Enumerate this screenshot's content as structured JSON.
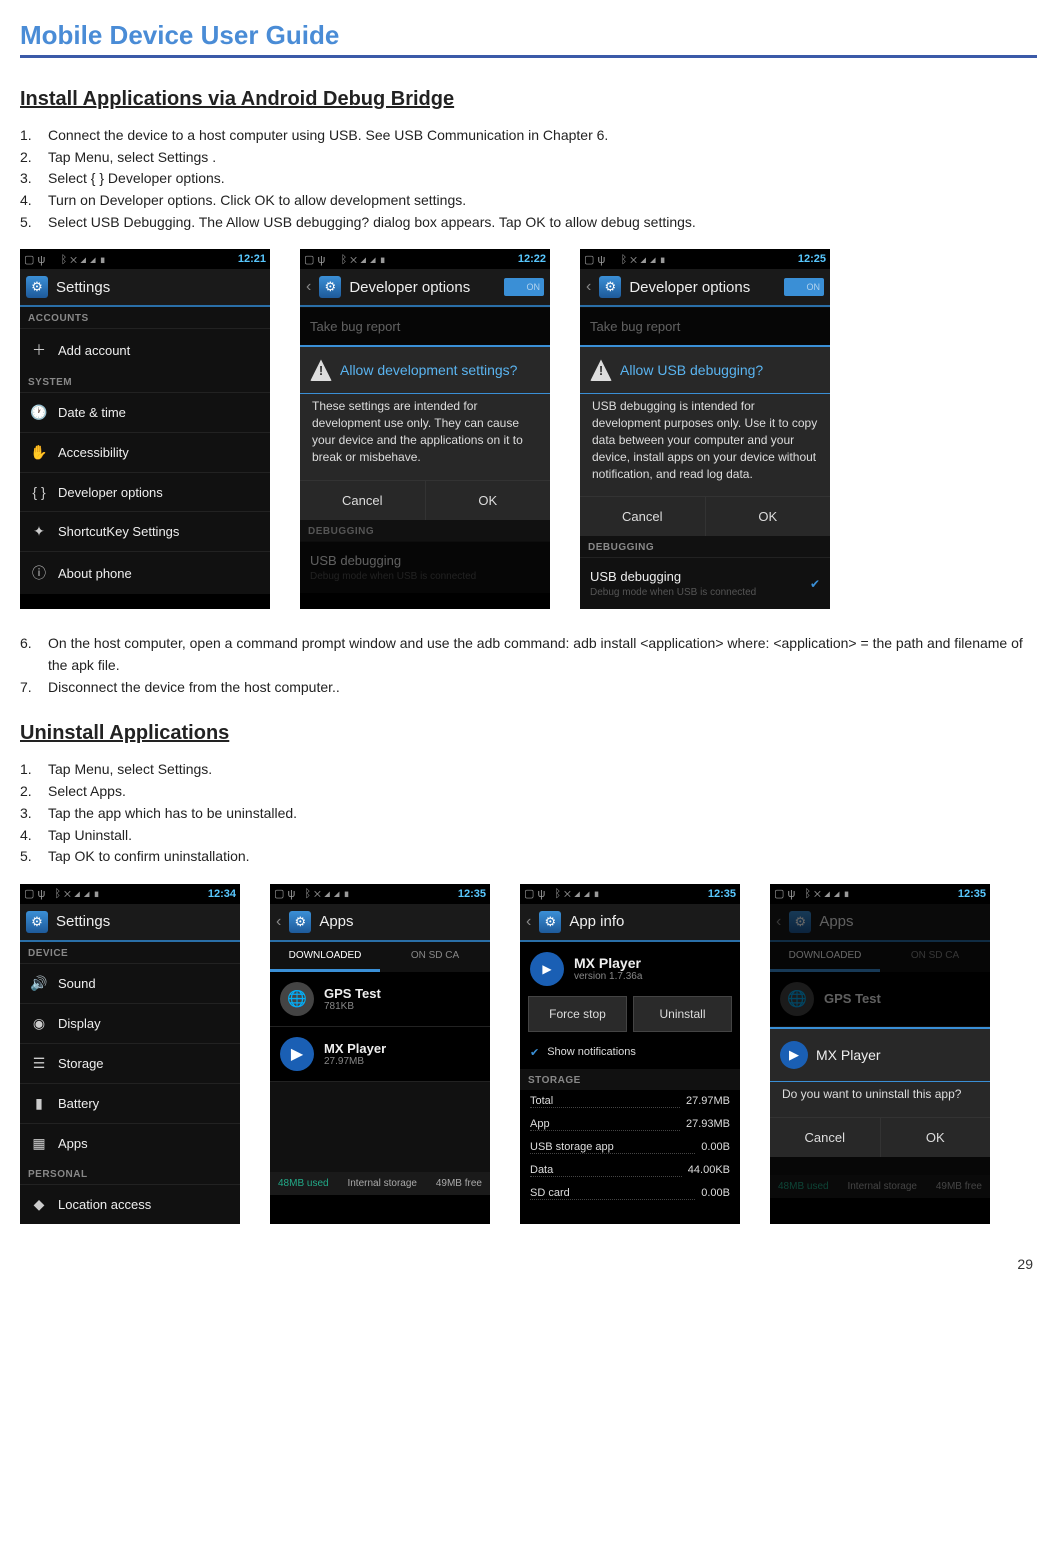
{
  "doc": {
    "title": "Mobile Device User Guide",
    "page": "29"
  },
  "section1": {
    "heading": "Install Applications via Android Debug Bridge",
    "steps": [
      "Connect the device to a host computer using USB. See USB Communication in Chapter 6.",
      "Tap Menu, select Settings .",
      "Select { } Developer options.",
      "Turn on Developer options. Click OK to allow development settings.",
      "Select USB Debugging. The Allow USB debugging? dialog box appears. Tap OK to allow debug settings."
    ],
    "steps2": [
      "On the host computer, open a command prompt window and use the adb command: adb install <application> where: <application> = the path and filename of the apk file.",
      "Disconnect the device from the host computer.."
    ]
  },
  "section2": {
    "heading": "Uninstall Applications",
    "steps": [
      "Tap Menu, select Settings.",
      "Select Apps.",
      "Tap the app which has to be uninstalled.",
      "Tap Uninstall.",
      "Tap OK to confirm uninstallation."
    ]
  },
  "shot1": {
    "clock": "12:21",
    "title": "Settings",
    "cat_accounts": "ACCOUNTS",
    "add_account": "Add account",
    "cat_system": "SYSTEM",
    "rows": [
      "Date & time",
      "Accessibility",
      "Developer options",
      "ShortcutKey Settings",
      "About phone"
    ]
  },
  "shot2": {
    "clock": "12:22",
    "title": "Developer options",
    "switch": "ON",
    "bug": "Take bug report",
    "dialog_title": "Allow development settings?",
    "dialog_body": "These settings are intended for development use only. They can cause your device and the applications on it to break or misbehave.",
    "cancel": "Cancel",
    "ok": "OK",
    "cat_debug": "DEBUGGING",
    "usb_row": "USB debugging",
    "usb_sub": "Debug mode when USB is connected"
  },
  "shot3": {
    "clock": "12:25",
    "title": "Developer options",
    "switch": "ON",
    "bug": "Take bug report",
    "dialog_title": "Allow USB debugging?",
    "dialog_body": "USB debugging is intended for development purposes only. Use it to copy data between your computer and your device, install apps on your device without notification, and read log data.",
    "cancel": "Cancel",
    "ok": "OK",
    "cat_debug": "DEBUGGING",
    "usb_row": "USB debugging",
    "usb_sub": "Debug mode when USB is connected"
  },
  "shotA": {
    "clock": "12:34",
    "title": "Settings",
    "cat_device": "DEVICE",
    "rows": [
      "Sound",
      "Display",
      "Storage",
      "Battery",
      "Apps"
    ],
    "cat_personal": "PERSONAL",
    "location": "Location access"
  },
  "shotB": {
    "clock": "12:35",
    "title": "Apps",
    "tab_dl": "DOWNLOADED",
    "tab_sd": "ON SD CA",
    "app1": {
      "name": "GPS Test",
      "size": "781KB"
    },
    "app2": {
      "name": "MX Player",
      "size": "27.97MB"
    },
    "bar_label": "Internal storage",
    "used": "48MB used",
    "free": "49MB free"
  },
  "shotC": {
    "clock": "12:35",
    "title": "App info",
    "app": {
      "name": "MX Player",
      "ver": "version 1.7.36a"
    },
    "force": "Force stop",
    "uninstall": "Uninstall",
    "notif": "Show notifications",
    "cat_storage": "STORAGE",
    "lines": [
      {
        "k": "Total",
        "v": "27.97MB"
      },
      {
        "k": "App",
        "v": "27.93MB"
      },
      {
        "k": "USB storage app",
        "v": "0.00B"
      },
      {
        "k": "Data",
        "v": "44.00KB"
      },
      {
        "k": "SD card",
        "v": "0.00B"
      }
    ]
  },
  "shotD": {
    "clock": "12:35",
    "title": "Apps",
    "tab_dl": "DOWNLOADED",
    "tab_sd": "ON SD CA",
    "app1": "GPS Test",
    "dialog_app": "MX Player",
    "dialog_body": "Do you want to uninstall this app?",
    "cancel": "Cancel",
    "ok": "OK",
    "bar_label": "Internal storage",
    "used": "48MB used",
    "free": "49MB free"
  }
}
